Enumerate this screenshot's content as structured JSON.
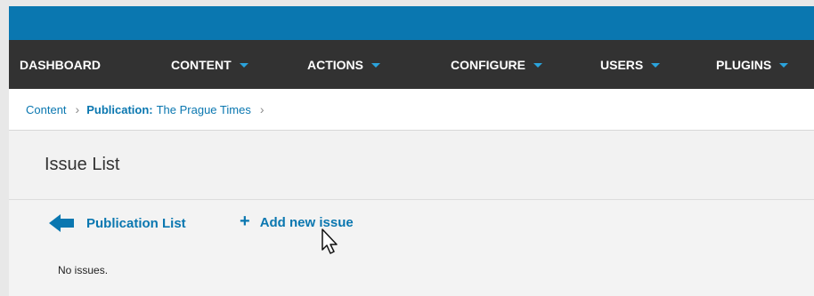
{
  "navbar": {
    "items": [
      {
        "label": "DASHBOARD"
      },
      {
        "label": "CONTENT"
      },
      {
        "label": "ACTIONS"
      },
      {
        "label": "CONFIGURE"
      },
      {
        "label": "USERS"
      },
      {
        "label": "PLUGINS"
      }
    ]
  },
  "breadcrumb": {
    "root": "Content",
    "publication_label": "Publication:",
    "publication_name": "The Prague Times"
  },
  "page": {
    "title": "Issue List"
  },
  "actions": {
    "publication_list": "Publication List",
    "add_new_issue": "Add new issue"
  },
  "content": {
    "empty_message": "No issues."
  },
  "colors": {
    "topbar": "#0a77b0",
    "navbar": "#323232",
    "accent": "#0a77b0",
    "caret": "#2aa3dc",
    "panel": "#f3f3f3"
  },
  "icons": {
    "back": "arrow-left-icon",
    "add": "plus-icon",
    "menu_caret": "chevron-down-icon",
    "breadcrumb_separator": "chevron-right-icon",
    "cursor": "mouse-pointer-icon"
  }
}
